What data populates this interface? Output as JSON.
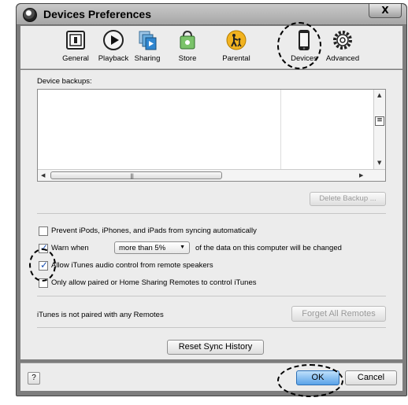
{
  "window": {
    "title": "Devices Preferences",
    "close_label": "X"
  },
  "toolbar": {
    "tabs": [
      {
        "label": "General",
        "icon": "general-icon"
      },
      {
        "label": "Playback",
        "icon": "play-icon"
      },
      {
        "label": "Sharing",
        "icon": "sharing-icon"
      },
      {
        "label": "Store",
        "icon": "store-bag-icon"
      },
      {
        "label": "Parental",
        "icon": "parental-icon"
      },
      {
        "label": "Devices",
        "icon": "device-phone-icon",
        "selected": true
      },
      {
        "label": "Advanced",
        "icon": "gear-icon"
      }
    ]
  },
  "backups": {
    "heading": "Device backups:",
    "delete_label": "Delete Backup ..."
  },
  "options": [
    {
      "label": "Prevent iPods, iPhones, and iPads from syncing automatically",
      "checked": false
    },
    {
      "prefix": "Warn when",
      "select_value": "more than 5%",
      "suffix": "of the data on this computer will be changed",
      "checked": true
    },
    {
      "label": "Allow iTunes audio control from remote speakers",
      "checked": true
    },
    {
      "label": "Only allow paired or Home Sharing Remotes to control iTunes",
      "checked": false
    }
  ],
  "remotes": {
    "status": "iTunes is not paired with any Remotes",
    "forget_label": "Forget All Remotes"
  },
  "reset_label": "Reset Sync History",
  "footer": {
    "help_label": "?",
    "ok_label": "OK",
    "cancel_label": "Cancel"
  },
  "colors": {
    "accent": "#1a4fb0",
    "ok_button": "#5aa2e8"
  }
}
